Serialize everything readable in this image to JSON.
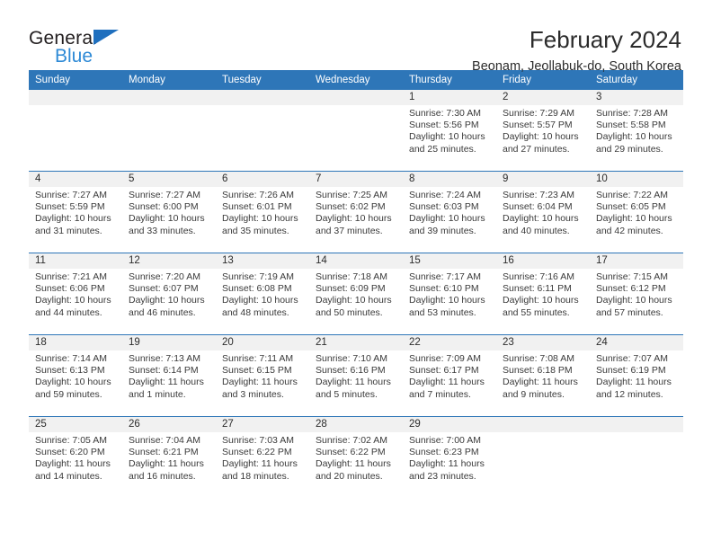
{
  "brand": {
    "name_top": "General",
    "name_bottom": "Blue",
    "triangle_icon": "brand-triangle-icon",
    "colors": {
      "dark": "#231f20",
      "blue": "#2e8ad6",
      "triangle": "#1f6fbe"
    }
  },
  "header": {
    "title": "February 2024",
    "subtitle": "Beonam, Jeollabuk-do, South Korea"
  },
  "theme": {
    "header_blue": "#2e76b8",
    "daynum_gray": "#f1f1f1",
    "text": "#2b2b2b"
  },
  "calendar": {
    "weekday_headers": [
      "Sunday",
      "Monday",
      "Tuesday",
      "Wednesday",
      "Thursday",
      "Friday",
      "Saturday"
    ],
    "weeks": [
      [
        {
          "day": "",
          "sunrise": "",
          "sunset": "",
          "daylight": ""
        },
        {
          "day": "",
          "sunrise": "",
          "sunset": "",
          "daylight": ""
        },
        {
          "day": "",
          "sunrise": "",
          "sunset": "",
          "daylight": ""
        },
        {
          "day": "",
          "sunrise": "",
          "sunset": "",
          "daylight": ""
        },
        {
          "day": "1",
          "sunrise": "Sunrise: 7:30 AM",
          "sunset": "Sunset: 5:56 PM",
          "daylight": "Daylight: 10 hours and 25 minutes."
        },
        {
          "day": "2",
          "sunrise": "Sunrise: 7:29 AM",
          "sunset": "Sunset: 5:57 PM",
          "daylight": "Daylight: 10 hours and 27 minutes."
        },
        {
          "day": "3",
          "sunrise": "Sunrise: 7:28 AM",
          "sunset": "Sunset: 5:58 PM",
          "daylight": "Daylight: 10 hours and 29 minutes."
        }
      ],
      [
        {
          "day": "4",
          "sunrise": "Sunrise: 7:27 AM",
          "sunset": "Sunset: 5:59 PM",
          "daylight": "Daylight: 10 hours and 31 minutes."
        },
        {
          "day": "5",
          "sunrise": "Sunrise: 7:27 AM",
          "sunset": "Sunset: 6:00 PM",
          "daylight": "Daylight: 10 hours and 33 minutes."
        },
        {
          "day": "6",
          "sunrise": "Sunrise: 7:26 AM",
          "sunset": "Sunset: 6:01 PM",
          "daylight": "Daylight: 10 hours and 35 minutes."
        },
        {
          "day": "7",
          "sunrise": "Sunrise: 7:25 AM",
          "sunset": "Sunset: 6:02 PM",
          "daylight": "Daylight: 10 hours and 37 minutes."
        },
        {
          "day": "8",
          "sunrise": "Sunrise: 7:24 AM",
          "sunset": "Sunset: 6:03 PM",
          "daylight": "Daylight: 10 hours and 39 minutes."
        },
        {
          "day": "9",
          "sunrise": "Sunrise: 7:23 AM",
          "sunset": "Sunset: 6:04 PM",
          "daylight": "Daylight: 10 hours and 40 minutes."
        },
        {
          "day": "10",
          "sunrise": "Sunrise: 7:22 AM",
          "sunset": "Sunset: 6:05 PM",
          "daylight": "Daylight: 10 hours and 42 minutes."
        }
      ],
      [
        {
          "day": "11",
          "sunrise": "Sunrise: 7:21 AM",
          "sunset": "Sunset: 6:06 PM",
          "daylight": "Daylight: 10 hours and 44 minutes."
        },
        {
          "day": "12",
          "sunrise": "Sunrise: 7:20 AM",
          "sunset": "Sunset: 6:07 PM",
          "daylight": "Daylight: 10 hours and 46 minutes."
        },
        {
          "day": "13",
          "sunrise": "Sunrise: 7:19 AM",
          "sunset": "Sunset: 6:08 PM",
          "daylight": "Daylight: 10 hours and 48 minutes."
        },
        {
          "day": "14",
          "sunrise": "Sunrise: 7:18 AM",
          "sunset": "Sunset: 6:09 PM",
          "daylight": "Daylight: 10 hours and 50 minutes."
        },
        {
          "day": "15",
          "sunrise": "Sunrise: 7:17 AM",
          "sunset": "Sunset: 6:10 PM",
          "daylight": "Daylight: 10 hours and 53 minutes."
        },
        {
          "day": "16",
          "sunrise": "Sunrise: 7:16 AM",
          "sunset": "Sunset: 6:11 PM",
          "daylight": "Daylight: 10 hours and 55 minutes."
        },
        {
          "day": "17",
          "sunrise": "Sunrise: 7:15 AM",
          "sunset": "Sunset: 6:12 PM",
          "daylight": "Daylight: 10 hours and 57 minutes."
        }
      ],
      [
        {
          "day": "18",
          "sunrise": "Sunrise: 7:14 AM",
          "sunset": "Sunset: 6:13 PM",
          "daylight": "Daylight: 10 hours and 59 minutes."
        },
        {
          "day": "19",
          "sunrise": "Sunrise: 7:13 AM",
          "sunset": "Sunset: 6:14 PM",
          "daylight": "Daylight: 11 hours and 1 minute."
        },
        {
          "day": "20",
          "sunrise": "Sunrise: 7:11 AM",
          "sunset": "Sunset: 6:15 PM",
          "daylight": "Daylight: 11 hours and 3 minutes."
        },
        {
          "day": "21",
          "sunrise": "Sunrise: 7:10 AM",
          "sunset": "Sunset: 6:16 PM",
          "daylight": "Daylight: 11 hours and 5 minutes."
        },
        {
          "day": "22",
          "sunrise": "Sunrise: 7:09 AM",
          "sunset": "Sunset: 6:17 PM",
          "daylight": "Daylight: 11 hours and 7 minutes."
        },
        {
          "day": "23",
          "sunrise": "Sunrise: 7:08 AM",
          "sunset": "Sunset: 6:18 PM",
          "daylight": "Daylight: 11 hours and 9 minutes."
        },
        {
          "day": "24",
          "sunrise": "Sunrise: 7:07 AM",
          "sunset": "Sunset: 6:19 PM",
          "daylight": "Daylight: 11 hours and 12 minutes."
        }
      ],
      [
        {
          "day": "25",
          "sunrise": "Sunrise: 7:05 AM",
          "sunset": "Sunset: 6:20 PM",
          "daylight": "Daylight: 11 hours and 14 minutes."
        },
        {
          "day": "26",
          "sunrise": "Sunrise: 7:04 AM",
          "sunset": "Sunset: 6:21 PM",
          "daylight": "Daylight: 11 hours and 16 minutes."
        },
        {
          "day": "27",
          "sunrise": "Sunrise: 7:03 AM",
          "sunset": "Sunset: 6:22 PM",
          "daylight": "Daylight: 11 hours and 18 minutes."
        },
        {
          "day": "28",
          "sunrise": "Sunrise: 7:02 AM",
          "sunset": "Sunset: 6:22 PM",
          "daylight": "Daylight: 11 hours and 20 minutes."
        },
        {
          "day": "29",
          "sunrise": "Sunrise: 7:00 AM",
          "sunset": "Sunset: 6:23 PM",
          "daylight": "Daylight: 11 hours and 23 minutes."
        },
        {
          "day": "",
          "sunrise": "",
          "sunset": "",
          "daylight": ""
        },
        {
          "day": "",
          "sunrise": "",
          "sunset": "",
          "daylight": ""
        }
      ]
    ]
  }
}
